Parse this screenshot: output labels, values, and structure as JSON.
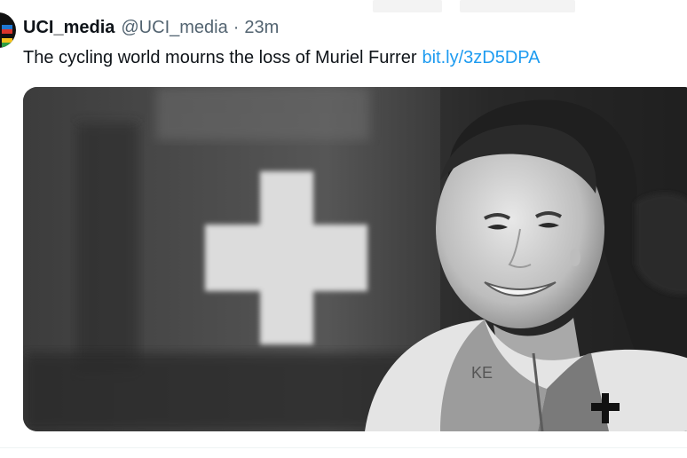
{
  "tweet": {
    "display_name": "UCI_media",
    "handle": "@UCI_media",
    "separator": "·",
    "timestamp": "23m",
    "text": "The cycling world mourns the loss of Muriel Furrer",
    "link": "bit.ly/3zD5DPA",
    "media_type": "black-and-white photo"
  },
  "colors": {
    "name": "#0f1419",
    "secondary": "#536471",
    "link": "#1d9bf0"
  }
}
